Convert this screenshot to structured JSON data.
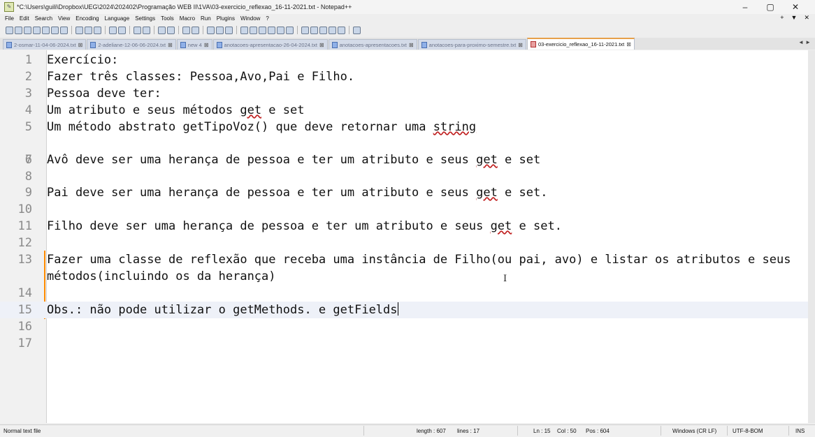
{
  "window": {
    "title": "*C:\\Users\\guili\\Dropbox\\UEG\\2024\\202402\\Programação WEB II\\1VA\\03-exercicio_reflexao_16-11-2021.txt - Notepad++",
    "controls": [
      "–",
      "▢",
      "✕"
    ]
  },
  "menu": {
    "items": [
      "File",
      "Edit",
      "Search",
      "View",
      "Encoding",
      "Language",
      "Settings",
      "Tools",
      "Macro",
      "Run",
      "Plugins",
      "Window",
      "?"
    ],
    "right": [
      "+",
      "▼",
      "✕"
    ]
  },
  "tabs": [
    {
      "label": "2-osmar-11-04-06-2024.txt",
      "active": false
    },
    {
      "label": "2-adeliane-12-06-06-2024.txt",
      "active": false
    },
    {
      "label": "new 4",
      "active": false
    },
    {
      "label": "anotacoes-apresentacao-26-04-2024.txt",
      "active": false
    },
    {
      "label": "anotacoes-apresentacoes.txt",
      "active": false
    },
    {
      "label": "anotacoes-para-proximo-semestre.txt",
      "active": false
    },
    {
      "label": "03-exercicio_reflexao_16-11-2021.txt",
      "active": true
    }
  ],
  "tab_arrows": "◄ ►",
  "editor": {
    "lines": [
      {
        "num": "1",
        "text": "Exercício:"
      },
      {
        "num": "2",
        "text": "Fazer três classes: Pessoa,Avo,Pai e Filho."
      },
      {
        "num": "3",
        "text": "Pessoa deve ter:"
      },
      {
        "num": "4",
        "pre": "Um atributo e seus métodos ",
        "flag": "get",
        "post": " e set"
      },
      {
        "num": "5",
        "pre": "Um método abstrato getTipoVoz() que deve retornar uma ",
        "flag": "string",
        "post": ""
      },
      {
        "num": "6",
        "text": ""
      },
      {
        "num": "7",
        "pre": "Avô deve ser uma herança de pessoa e ter um atributo e seus ",
        "flag": "get",
        "post": " e set"
      },
      {
        "num": "8",
        "text": ""
      },
      {
        "num": "9",
        "pre": "Pai deve ser uma herança de pessoa e ter um atributo e seus ",
        "flag": "get",
        "post": " e set."
      },
      {
        "num": "10",
        "text": ""
      },
      {
        "num": "11",
        "pre": "Filho deve ser uma herança de pessoa e ter um atributo e seus ",
        "flag": "get",
        "post": " e set."
      },
      {
        "num": "12",
        "text": ""
      },
      {
        "num": "13",
        "text": "Fazer uma classe de reflexão que receba uma instância de Filho(ou pai, avo) e listar os atributos e seus métodos(incluindo os da herança)"
      },
      {
        "num": "14",
        "text": ""
      },
      {
        "num": "15",
        "text": "Obs.: não pode utilizar o getMethods. e getFields"
      },
      {
        "num": "16",
        "text": ""
      },
      {
        "num": "17",
        "text": ""
      }
    ]
  },
  "status": {
    "file_type": "Normal text file",
    "length": "length : 607",
    "lines": "lines : 17",
    "ln": "Ln : 15",
    "col": "Col : 50",
    "pos": "Pos : 604",
    "eol": "Windows (CR LF)",
    "encoding": "UTF-8-BOM",
    "mode": "INS"
  }
}
